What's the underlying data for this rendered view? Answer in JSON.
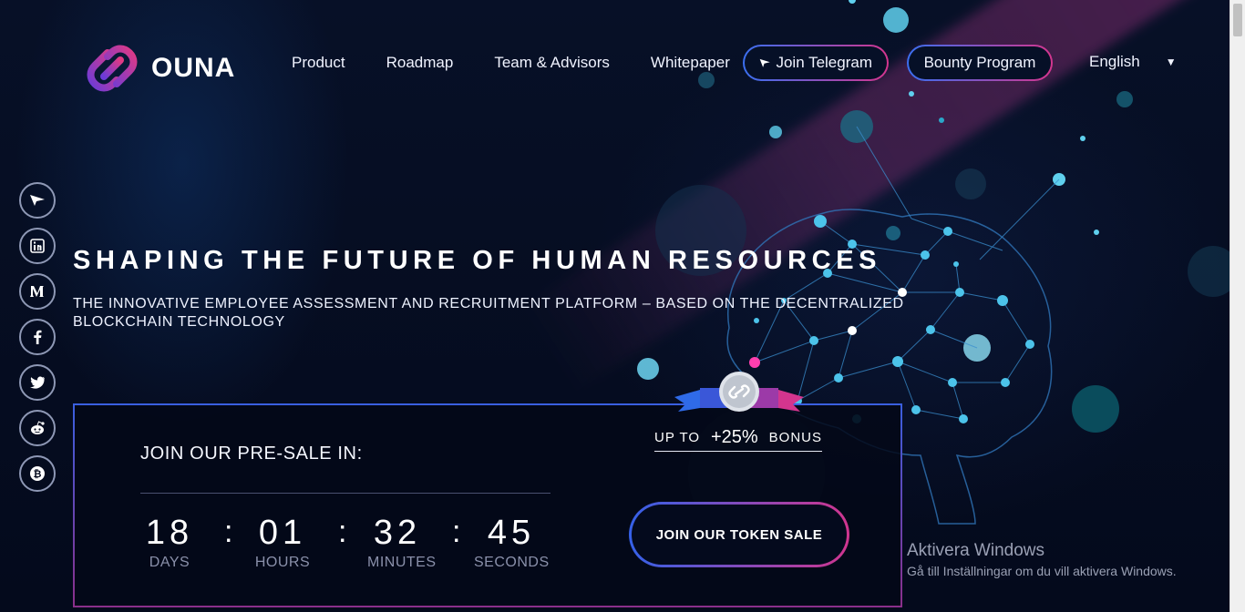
{
  "brand": {
    "name": "OUNA"
  },
  "nav": {
    "links": [
      "Product",
      "Roadmap",
      "Team & Advisors",
      "Whitepaper"
    ],
    "telegram_label": "Join Telegram",
    "bounty_label": "Bounty Program",
    "language": "English"
  },
  "social": [
    "telegram-icon",
    "linkedin-icon",
    "medium-icon",
    "facebook-icon",
    "twitter-icon",
    "reddit-icon",
    "bitcointalk-icon"
  ],
  "hero": {
    "headline": "SHAPING THE FUTURE OF HUMAN RESOURCES",
    "subline": "THE INNOVATIVE EMPLOYEE ASSESSMENT AND RECRUITMENT PLATFORM – BASED ON THE DECENTRALIZED BLOCKCHAIN TECHNOLOGY"
  },
  "presale": {
    "title": "JOIN OUR PRE-SALE IN:",
    "countdown": {
      "days": "18",
      "days_label": "DAYS",
      "hours": "01",
      "hours_label": "HOURS",
      "minutes": "32",
      "minutes_label": "MINUTES",
      "seconds": "45",
      "seconds_label": "SECONDS"
    },
    "token_button": "JOIN OUR TOKEN SALE"
  },
  "bonus": {
    "prefix": "UP TO",
    "percent": "+25%",
    "suffix": "BONUS"
  },
  "watermark": {
    "title": "Aktivera Windows",
    "subtitle": "Gå till Inställningar om du vill aktivera Windows."
  },
  "colors": {
    "accent_blue": "#3a6ff0",
    "accent_pink": "#d4358e",
    "node_cyan": "#4cc3ea",
    "background": "#050b1e"
  }
}
